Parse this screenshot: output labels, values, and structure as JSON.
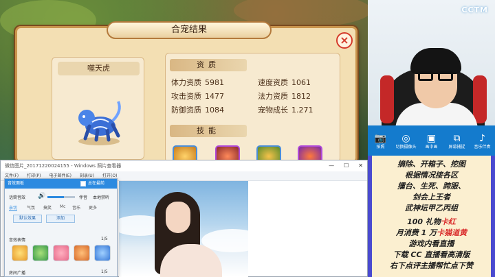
{
  "game": {
    "dialog_title": "合宠结果",
    "close_label": "×",
    "pet_name": "噬天虎",
    "aptitude_header": "资质",
    "skills_header": "技能",
    "stats": [
      {
        "label": "体力资质",
        "value": "5981"
      },
      {
        "label": "速度资质",
        "value": "1061"
      },
      {
        "label": "攻击资质",
        "value": "1477"
      },
      {
        "label": "法力资质",
        "value": "1812"
      },
      {
        "label": "防御资质",
        "value": "1084"
      },
      {
        "label": "宠物成长",
        "value": "1.271"
      }
    ]
  },
  "stream": {
    "logo": "CCTM",
    "toolbar": [
      {
        "icon": "camera-icon",
        "glyph": "📷",
        "label": "拍照"
      },
      {
        "icon": "camera-switch-icon",
        "glyph": "◎",
        "label": "切换摄像头"
      },
      {
        "icon": "picture-in-picture-icon",
        "glyph": "▣",
        "label": "画中画"
      },
      {
        "icon": "screen-capture-icon",
        "glyph": "⧉",
        "label": "屏幕捕捉"
      },
      {
        "icon": "music-icon",
        "glyph": "♪",
        "label": "音乐伴奏"
      }
    ],
    "info_lines": [
      {
        "text": "摘除、开箱子、挖图",
        "hl": ""
      },
      {
        "text": "根据情况接各区",
        "hl": ""
      },
      {
        "text": "擂台、生死、跨服、",
        "hl": ""
      },
      {
        "text": "剑会上王者",
        "hl": ""
      },
      {
        "text": "武神坛甲乙丙组",
        "hl": ""
      },
      {
        "text": "100 礼物",
        "hl": "卡红"
      },
      {
        "text": "月消费 1 万",
        "hl": "卡猫道黄"
      },
      {
        "text": "游戏内看直播",
        "hl": ""
      },
      {
        "text": "下载 CC 直播看高清版",
        "hl": ""
      },
      {
        "text": "右下点评主播帮忙点下赞",
        "hl": ""
      }
    ]
  },
  "viewer": {
    "title": "微信图片_20171220024155 - Windows 照片查看器",
    "controls": {
      "minimize": "—",
      "maximize": "☐",
      "close": "✕"
    },
    "menu": [
      "文件(F)",
      "打印(P)",
      "电子邮件(E)",
      "刻录(U)",
      "打开(O)"
    ]
  },
  "sound": {
    "title": "音效面板",
    "always_top": "总在最前",
    "mic_label": "话筒音效",
    "volume_label": "伴音",
    "mute_label": "本地禁听",
    "volume_level": 0.6,
    "tabs": [
      "亲切",
      "气氛",
      "搞笑",
      "Mc",
      "音乐",
      "更多"
    ],
    "active_tab": 0,
    "buttons": [
      "默认效果",
      "添加"
    ],
    "effects_label": "音效表情",
    "effects_count": "1/5",
    "broadcast_label": "房间广播",
    "broadcast_count": "1/5"
  }
}
